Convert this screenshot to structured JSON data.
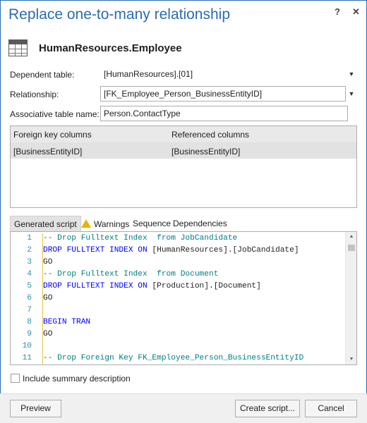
{
  "window": {
    "title": "Replace one-to-many relationship",
    "help_glyph": "?",
    "close_glyph": "✕"
  },
  "entity": {
    "icon": "table-icon",
    "name": "HumanResources.Employee"
  },
  "form": {
    "dependent_table_label": "Dependent table:",
    "dependent_table_value": "[HumanResources].[01]",
    "relationship_label": "Relationship:",
    "relationship_value": "[FK_Employee_Person_BusinessEntityID]",
    "assoc_table_label": "Associative table name:",
    "assoc_table_value": "Person.ContactType",
    "dropdown_glyph": "▼"
  },
  "columns_grid": {
    "headers": [
      "Foreign key columns",
      "Referenced columns"
    ],
    "rows": [
      [
        "[BusinessEntityID]",
        "[BusinessEntityID]"
      ]
    ]
  },
  "tabs": [
    {
      "label": "Generated script",
      "active": true
    },
    {
      "label": "Warnings",
      "icon": "warning-icon"
    },
    {
      "label": "Sequence"
    },
    {
      "label": "Dependencies"
    }
  ],
  "script": {
    "lines": [
      {
        "no": "1",
        "parts": [
          [
            "cm",
            "-- Drop Fulltext Index  from JobCandidate"
          ]
        ]
      },
      {
        "no": "2",
        "parts": [
          [
            "kw",
            "DROP FULLTEXT INDEX ON "
          ],
          [
            "id",
            "[HumanResources].[JobCandidate]"
          ]
        ]
      },
      {
        "no": "3",
        "parts": [
          [
            "id",
            "GO"
          ]
        ]
      },
      {
        "no": "4",
        "parts": [
          [
            "cm",
            "-- Drop Fulltext Index  from Document"
          ]
        ]
      },
      {
        "no": "5",
        "parts": [
          [
            "kw",
            "DROP FULLTEXT INDEX ON "
          ],
          [
            "id",
            "[Production].[Document]"
          ]
        ]
      },
      {
        "no": "6",
        "parts": [
          [
            "id",
            "GO"
          ]
        ]
      },
      {
        "no": "7",
        "parts": []
      },
      {
        "no": "8",
        "parts": [
          [
            "kw",
            "BEGIN TRAN"
          ]
        ]
      },
      {
        "no": "9",
        "parts": [
          [
            "id",
            "GO"
          ]
        ]
      },
      {
        "no": "10",
        "parts": []
      },
      {
        "no": "11",
        "parts": [
          [
            "cm",
            "-- Drop Foreign Key FK_Employee_Person_BusinessEntityID"
          ]
        ]
      }
    ]
  },
  "summary_checkbox": {
    "label": "Include summary description",
    "checked": false
  },
  "buttons": {
    "preview": "Preview",
    "create_script": "Create script...",
    "cancel": "Cancel"
  },
  "colors": {
    "accent": "#2b6cb3",
    "keyword": "#0000ff",
    "comment": "#008080",
    "line_number": "#2b91af",
    "warning": "#e8b400"
  }
}
